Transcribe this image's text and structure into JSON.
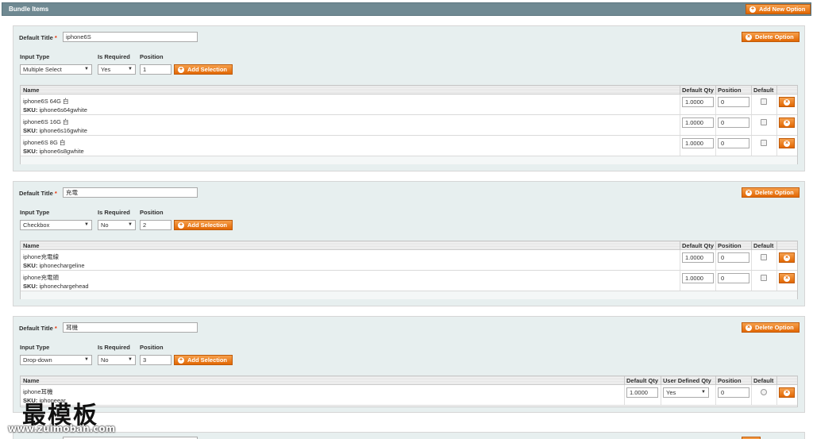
{
  "header": {
    "title": "Bundle Items",
    "add_new_option_label": "Add New Option"
  },
  "common": {
    "default_title_label": "Default Title",
    "required_mark": "*",
    "input_type_label": "Input Type",
    "is_required_label": "Is Required",
    "position_label": "Position",
    "add_selection_label": "Add Selection",
    "delete_option_label": "Delete Option",
    "col_name": "Name",
    "col_default_qty": "Default Qty",
    "col_user_defined_qty": "User Defined Qty",
    "col_position": "Position",
    "col_default": "Default",
    "sku_label": "SKU:"
  },
  "options": [
    {
      "default_title": "iphone6S",
      "input_type": "Multiple Select",
      "is_required": "Yes",
      "position": "1",
      "rows": [
        {
          "name": "iphone6S 64G 白",
          "sku": "iphone6s64gwhite",
          "qty": "1.0000",
          "position": "0"
        },
        {
          "name": "iphone6S 16G 白",
          "sku": "iphone6s16gwhite",
          "qty": "1.0000",
          "position": "0"
        },
        {
          "name": "iphone6S 8G 白",
          "sku": "iphone6s8gwhite",
          "qty": "1.0000",
          "position": "0"
        }
      ]
    },
    {
      "default_title": "充電",
      "input_type": "Checkbox",
      "is_required": "No",
      "position": "2",
      "rows": [
        {
          "name": "iphone充電線",
          "sku": "iphonechargeline",
          "qty": "1.0000",
          "position": "0"
        },
        {
          "name": "iphone充電頭",
          "sku": "iphonechargehead",
          "qty": "1.0000",
          "position": "0"
        }
      ]
    },
    {
      "default_title": "耳機",
      "input_type": "Drop-down",
      "is_required": "No",
      "position": "3",
      "rows": [
        {
          "name": "iphone耳機",
          "sku": "iphoneear",
          "qty": "1.0000",
          "user_defined_qty": "Yes",
          "position": "0"
        }
      ]
    }
  ],
  "watermark": {
    "text": "最模板",
    "url": "www.zuimoban.com"
  },
  "icons": {
    "add": "plus-circle-icon",
    "delete": "x-circle-icon",
    "dropdown": "chevron-down-icon"
  },
  "colors": {
    "header_bg": "#6f8992",
    "button_orange": "#e26703",
    "option_bg": "#e7efef"
  }
}
